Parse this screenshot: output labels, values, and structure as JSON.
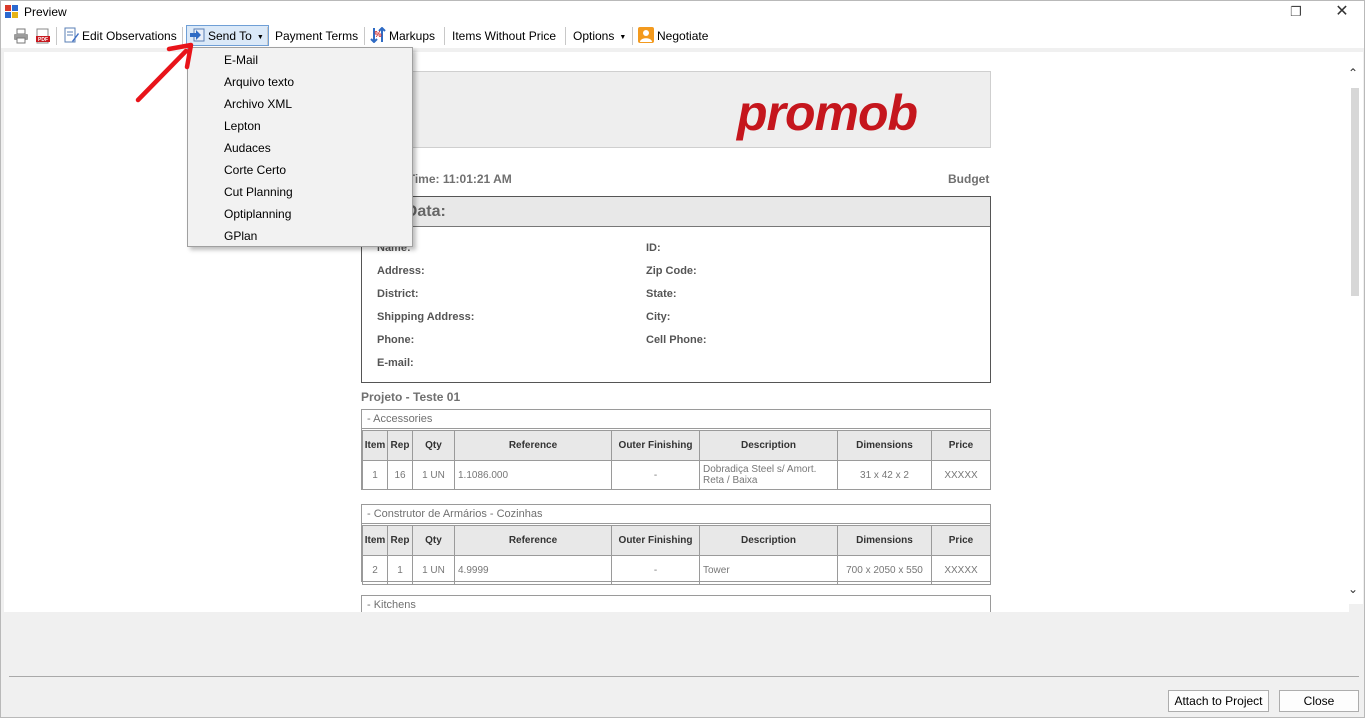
{
  "window": {
    "title": "Preview"
  },
  "toolbar": {
    "edit_observations": "Edit Observations",
    "send_to": "Send To",
    "payment_terms": "Payment Terms",
    "markups": "Markups",
    "items_without_price": "Items Without Price",
    "options": "Options",
    "negotiate": "Negotiate"
  },
  "send_to_menu": {
    "items": [
      "E-Mail",
      "Arquivo texto",
      "Archivo XML",
      "Lepton",
      "Audaces",
      "Corte Certo",
      "Cut Planning",
      "Optiplanning",
      "GPlan"
    ]
  },
  "document": {
    "logo": "promob",
    "date_line": "16/2023   Time: 11:01:21 AM",
    "doc_type": "Budget",
    "customer_title": "mer Data:",
    "fields_left": [
      "Name:",
      "Address:",
      "District:",
      "Shipping Address:",
      "Phone:",
      "E-mail:"
    ],
    "fields_right": [
      "ID:",
      "Zip Code:",
      "State:",
      "City:",
      "Cell Phone:"
    ],
    "project": "Projeto - Teste 01",
    "columns": [
      "Item",
      "Rep",
      "Qty",
      "Reference",
      "Outer Finishing",
      "Description",
      "Dimensions",
      "Price"
    ],
    "sections": [
      {
        "title": "- Accessories",
        "row": [
          "1",
          "16",
          "1 UN",
          "1.1086.000",
          "-",
          "Dobradiça Steel s/ Amort. Reta / Baixa",
          "31 x 42 x 2",
          "XXXXX"
        ]
      },
      {
        "title": "- Construtor de Armários - Cozinhas",
        "row": [
          "2",
          "1",
          "1 UN",
          "4.9999",
          "-",
          "Tower",
          "700 x 2050 x 550",
          "XXXXX"
        ]
      },
      {
        "title": "- Kitchens"
      }
    ]
  },
  "buttons": {
    "attach": "Attach to Project",
    "close": "Close"
  },
  "colors": {
    "logo_red": "#c5161d",
    "annotation_red": "#e8141a"
  }
}
